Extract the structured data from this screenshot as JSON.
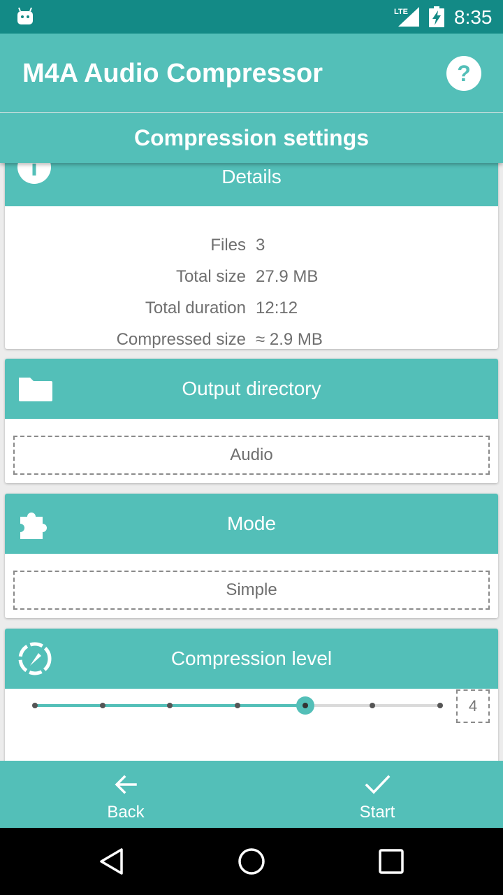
{
  "status_bar": {
    "time": "8:35",
    "network": "LTE",
    "icons": [
      "android-icon",
      "lte-signal-icon",
      "battery-charging-icon"
    ]
  },
  "app_bar": {
    "title": "M4A Audio Compressor",
    "help_icon": "help-circle-icon"
  },
  "sub_header": {
    "title": "Compression settings"
  },
  "details_card": {
    "title": "Details",
    "icon": "info-icon",
    "rows": [
      {
        "label": "Files",
        "value": "3"
      },
      {
        "label": "Total size",
        "value": "27.9 MB"
      },
      {
        "label": "Total duration",
        "value": "12:12"
      },
      {
        "label": "Compressed size",
        "value": "≈ 2.9 MB"
      }
    ]
  },
  "output_card": {
    "title": "Output directory",
    "icon": "folder-icon",
    "value": "Audio"
  },
  "mode_card": {
    "title": "Mode",
    "icon": "puzzle-icon",
    "value": "Simple"
  },
  "compression_card": {
    "title": "Compression level",
    "icon": "gauge-icon",
    "level": "4",
    "slider": {
      "min": 0,
      "max": 6,
      "value": 4,
      "steps": 7
    }
  },
  "bottom_bar": {
    "back_label": "Back",
    "start_label": "Start",
    "back_icon": "arrow-left-icon",
    "start_icon": "check-icon"
  },
  "nav_bar": {
    "icons": [
      "back-triangle-icon",
      "home-circle-icon",
      "recents-square-icon"
    ]
  },
  "colors": {
    "primary": "#53bfb8",
    "status_bar": "#138a86",
    "text_gray": "#6f6f6f"
  }
}
